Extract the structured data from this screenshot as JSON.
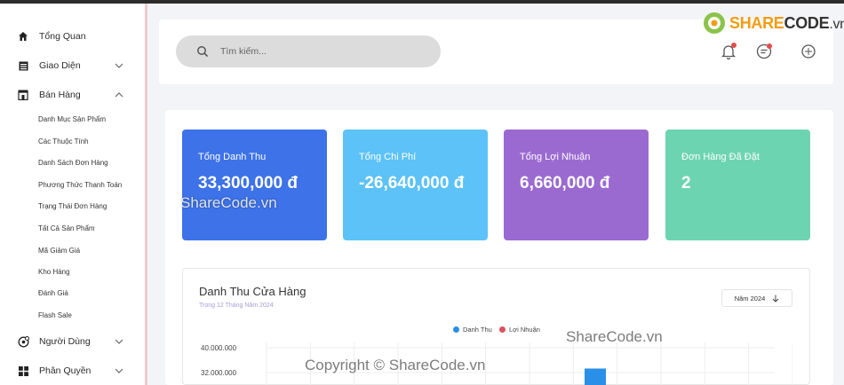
{
  "sidebar": {
    "items": [
      {
        "label": "Tổng Quan",
        "icon": "home-icon"
      },
      {
        "label": "Giao Diện",
        "icon": "layout-icon"
      },
      {
        "label": "Bán Hàng",
        "icon": "store-icon"
      },
      {
        "label": "Người Dùng",
        "icon": "user-settings-icon"
      },
      {
        "label": "Phân Quyền",
        "icon": "grid-icon"
      }
    ],
    "sales_submenu": [
      "Danh Mục Sản Phẩm",
      "Các Thuộc Tính",
      "Danh Sách Đơn Hàng",
      "Phương Thức Thanh Toán",
      "Trạng Thái Đơn Hàng",
      "Tất Cả Sản Phẩm",
      "Mã Giảm Giá",
      "Kho Hàng",
      "Đánh Giá",
      "Flash Sale"
    ]
  },
  "header": {
    "search_placeholder": "Tìm kiếm...",
    "logo_brand": "SHARE",
    "logo_rest": "CODE",
    "logo_tld": ".vn"
  },
  "stats": [
    {
      "title": "Tổng Danh Thu",
      "value": "33,300,000 đ",
      "color": "#3d72e8"
    },
    {
      "title": "Tổng Chi Phí",
      "value": "-26,640,000 đ",
      "color": "#5cc2f7"
    },
    {
      "title": "Tổng Lợi Nhuận",
      "value": "6,660,000 đ",
      "color": "#9b6ad1"
    },
    {
      "title": "Đơn Hàng Đã Đặt",
      "value": "2",
      "color": "#6dd4b1"
    }
  ],
  "chart_section": {
    "title": "Danh Thu Cửa Hàng",
    "subtitle": "Trong 12 Tháng Năm 2024",
    "year_button": "Năm 2024"
  },
  "chart_data": {
    "type": "bar",
    "series": [
      {
        "name": "Danh Thu",
        "color": "#2a8fe6"
      },
      {
        "name": "Lợi Nhuận",
        "color": "#e0505f"
      }
    ],
    "y_ticks": [
      "40.000.000",
      "32.000.000"
    ],
    "visible_bar_value": 33300000
  },
  "watermarks": {
    "center": "ShareCode.vn",
    "right": "ShareCode.vn",
    "bottom": "Copyright © ShareCode.vn"
  }
}
